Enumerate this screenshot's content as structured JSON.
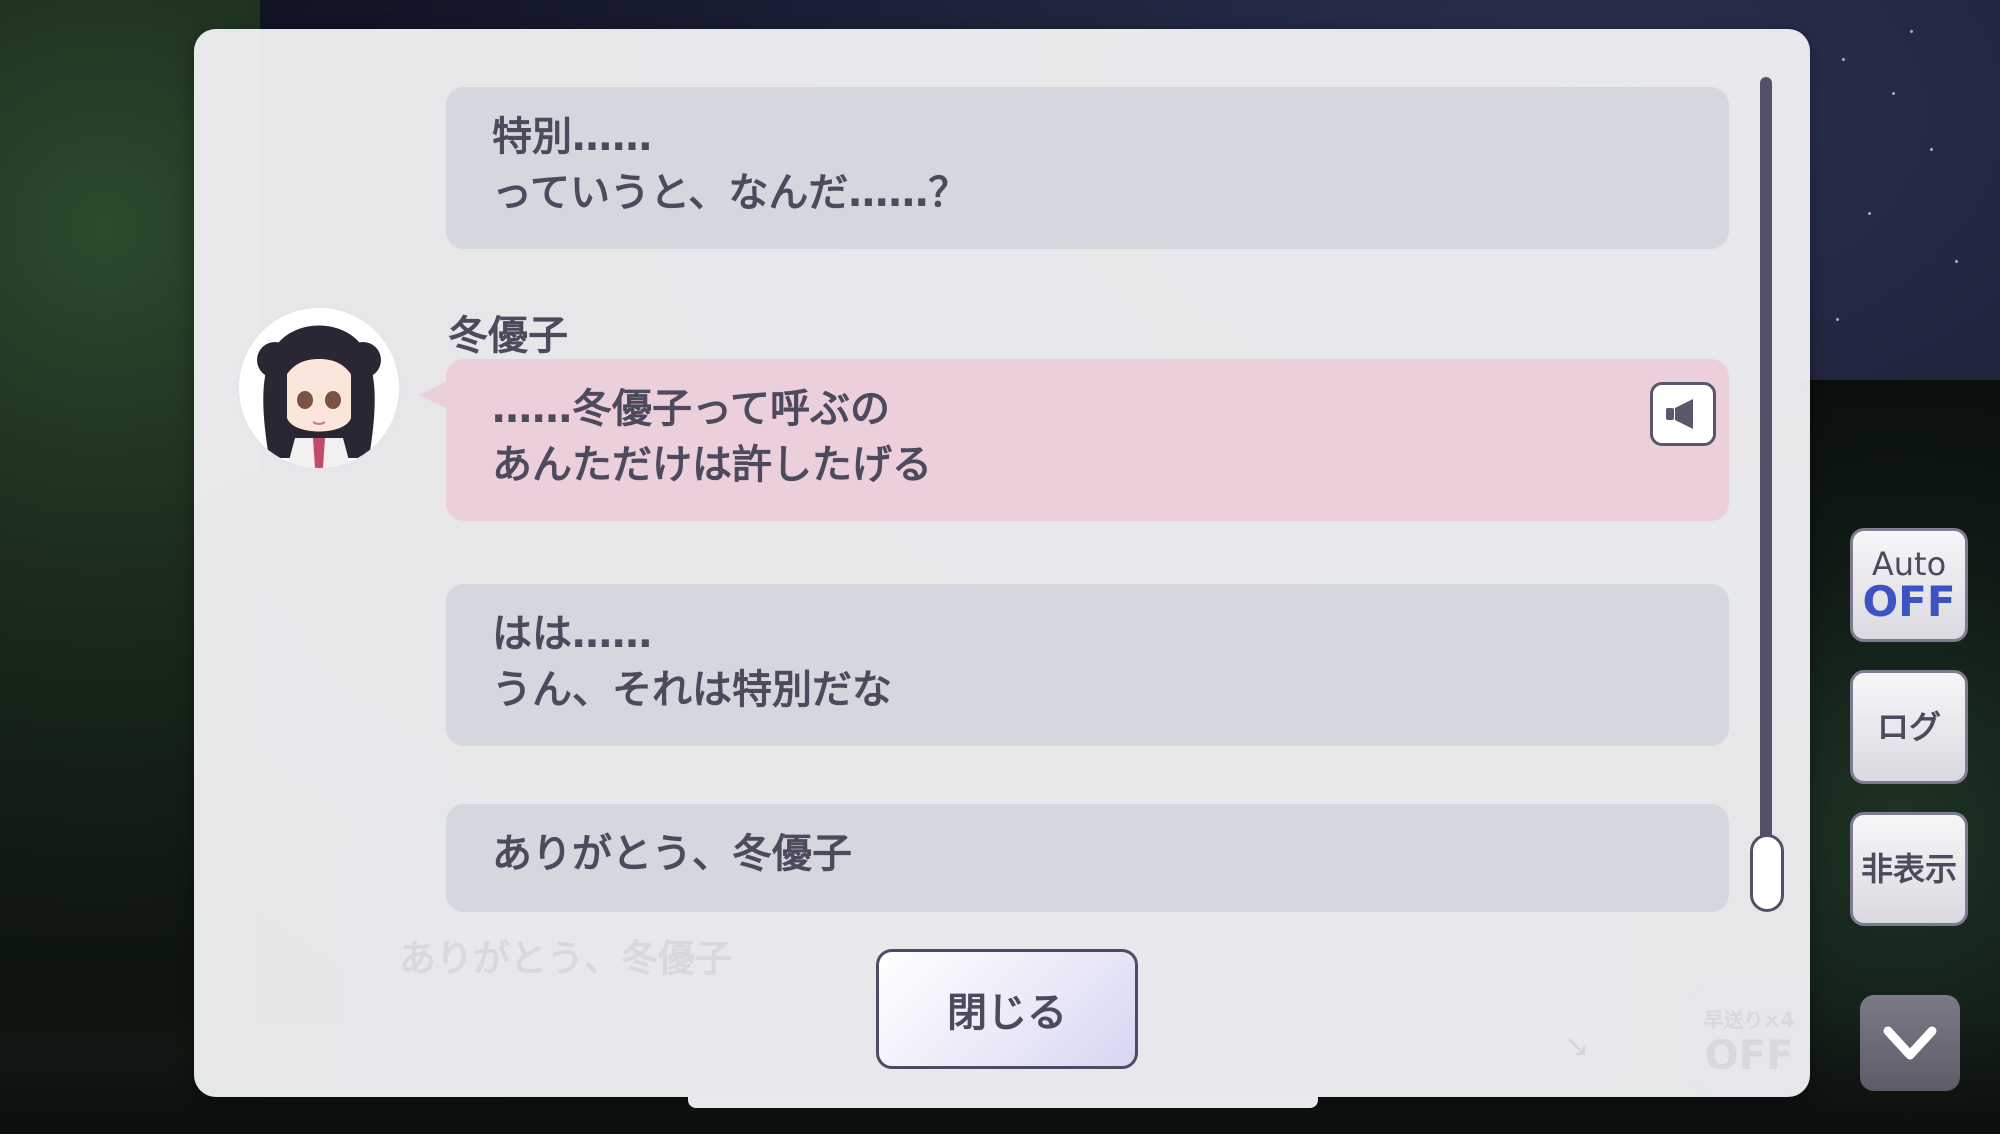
{
  "log": {
    "messages": [
      {
        "speaker": "",
        "lines": [
          "特別……",
          "っていうと、なんだ……？"
        ]
      },
      {
        "speaker": "冬優子",
        "lines": [
          "……冬優子って呼ぶの",
          "あんただけは許したげる"
        ]
      },
      {
        "speaker": "",
        "lines": [
          "はは……",
          "うん、それは特別だな"
        ]
      },
      {
        "speaker": "",
        "lines": [
          "ありがとう、冬優子"
        ]
      }
    ],
    "close_label": "閉じる"
  },
  "background_textbox": {
    "text": "ありがとう、冬優子",
    "speed_label": "早送り×4",
    "speed_value": "OFF"
  },
  "side_controls": {
    "auto_label": "Auto",
    "auto_value": "OFF",
    "log_label": "ログ",
    "hide_label": "非表示"
  },
  "icons": {
    "voice": "speaker-icon",
    "down": "chevron-down-icon",
    "next": "arrow-down-right-icon"
  },
  "colors": {
    "bubble_gray": "#d4d7de",
    "bubble_pink": "#ebd0dc",
    "text": "#4e4a5e",
    "auto_off": "#3e53c2"
  }
}
